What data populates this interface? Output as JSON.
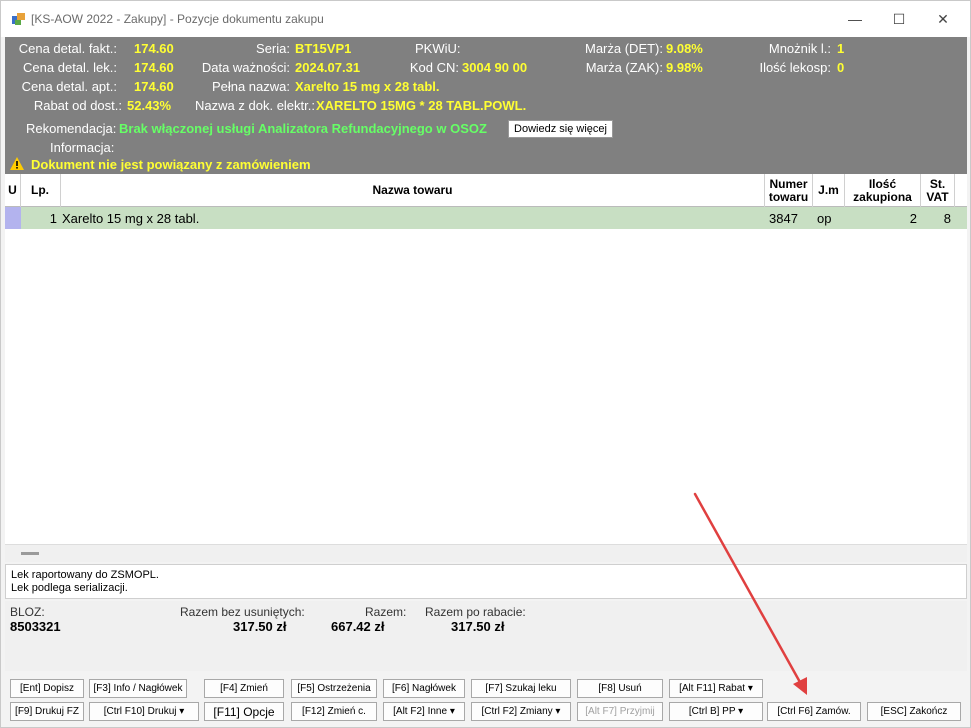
{
  "window": {
    "title": "[KS-AOW 2022 - Zakupy] - Pozycje dokumentu zakupu",
    "minimize": "—",
    "maximize": "☐",
    "close": "✕"
  },
  "info": {
    "cena_fakt_label": "Cena detal. fakt.:",
    "cena_fakt_value": "174.60",
    "cena_lek_label": "Cena detal. lek.:",
    "cena_lek_value": "174.60",
    "cena_apt_label": "Cena detal. apt.:",
    "cena_apt_value": "174.60",
    "rabat_label": "Rabat od dost.:",
    "rabat_value": "52.43%",
    "seria_label": "Seria:",
    "seria_value": "BT15VP1",
    "data_label": "Data ważności:",
    "data_value": "2024.07.31",
    "pelna_label": "Pełna nazwa:",
    "pelna_value": "Xarelto 15 mg x 28 tabl.",
    "nazwa_el_label": "Nazwa z dok. elektr.:",
    "nazwa_el_value": "XARELTO 15MG * 28 TABL.POWL.",
    "pkwiu_label": "PKWiU:",
    "kodcn_label": "Kod CN:",
    "kodcn_value": "3004 90 00",
    "marza_det_label": "Marża (DET):",
    "marza_det_value": "9.08%",
    "marza_zak_label": "Marża (ZAK):",
    "marza_zak_value": "9.98%",
    "mnoznik_label": "Mnożnik l.:",
    "mnoznik_value": "1",
    "ilosc_lekosp_label": "Ilość lekosp:",
    "ilosc_lekosp_value": "0",
    "rekomendacja_label": "Rekomendacja:",
    "rekomendacja_value": "Brak włączonej usługi Analizatora Refundacyjnego w OSOZ",
    "learn_more": "Dowiedz się więcej",
    "informacja_label": "Informacja:",
    "warning": "Dokument nie jest powiązany z zamówieniem"
  },
  "table": {
    "headers": {
      "u": "U",
      "lp": "Lp.",
      "nazwa": "Nazwa towaru",
      "numer_1": "Numer",
      "numer_2": "towaru",
      "jm": "J.m",
      "ilosc_1": "Ilość",
      "ilosc_2": "zakupiona",
      "vat_1": "St.",
      "vat_2": "VAT"
    },
    "rows": [
      {
        "lp": "1",
        "nazwa": "Xarelto 15 mg x 28 tabl.",
        "numer": "3847",
        "jm": "op",
        "ilosc": "2",
        "vat": "8"
      }
    ]
  },
  "notes": {
    "line1": "Lek raportowany do ZSMOPL.",
    "line2": "Lek podlega serializacji."
  },
  "totals": {
    "bloz_label": "BLOZ:",
    "bloz_value": "8503321",
    "bez_label": "Razem bez usuniętych:",
    "bez_value": "317.50 zł",
    "razem_label": "Razem:",
    "razem_value": "667.42 zł",
    "po_rabacie_label": "Razem po rabacie:",
    "po_rabacie_value": "317.50 zł"
  },
  "buttons_row1": [
    "[Ent] Dopisz",
    "[F3] Info / Nagłówek",
    "[F4] Zmień",
    "[F5] Ostrzeżenia",
    "[F6] Nagłówek",
    "[F7] Szukaj leku",
    "[F8] Usuń",
    "[Alt F11] Rabat ▾"
  ],
  "buttons_row2": [
    "[F9] Drukuj FZ",
    "[Ctrl F10] Drukuj ▾",
    "[F11] Opcje",
    "[F12] Zmień c.",
    "[Alt F2] Inne ▾",
    "[Ctrl F2] Zmiany ▾",
    "[Alt F7] Przyjmij",
    "[Ctrl B] PP ▾",
    "[Ctrl F6] Zamów.",
    "[ESC] Zakończ"
  ],
  "colors": {
    "panel": "#808080",
    "value_yellow": "#ffff33",
    "value_green": "#66ff66",
    "row_selected": "#c8dfc3",
    "annotation_arrow": "#e04040"
  }
}
